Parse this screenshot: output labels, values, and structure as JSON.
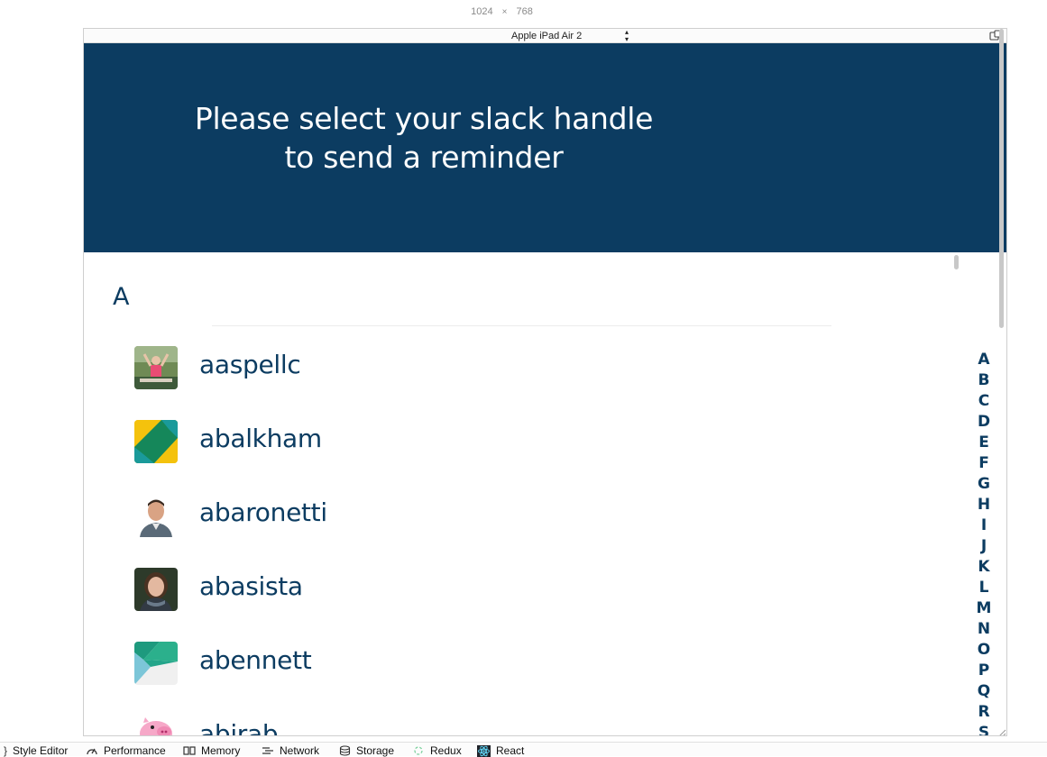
{
  "responsive": {
    "width": "1024",
    "times": "×",
    "height": "768",
    "device": "Apple iPad Air 2"
  },
  "header": {
    "line1": "Please select your slack handle",
    "line2": "to send a reminder",
    "background": "#0c3c61"
  },
  "section": {
    "letter": "A"
  },
  "users": [
    {
      "handle": "aaspellc",
      "avatar": "photo-kayaker-avatar"
    },
    {
      "handle": "abalkham",
      "avatar": "yellow-green-pattern-avatar"
    },
    {
      "handle": "abaronetti",
      "avatar": "photo-man-avatar"
    },
    {
      "handle": "abasista",
      "avatar": "photo-woman-avatar"
    },
    {
      "handle": "abennett",
      "avatar": "teal-pattern-avatar"
    },
    {
      "handle": "abirab",
      "avatar": "pink-pig-avatar"
    }
  ],
  "alphabet": [
    "A",
    "B",
    "C",
    "D",
    "E",
    "F",
    "G",
    "H",
    "I",
    "J",
    "K",
    "L",
    "M",
    "N",
    "O",
    "P",
    "Q",
    "R",
    "S"
  ],
  "devtools": {
    "tabs": [
      {
        "label": "Style Editor",
        "icon": "brace-icon"
      },
      {
        "label": "Performance",
        "icon": "gauge-icon"
      },
      {
        "label": "Memory",
        "icon": "memory-chip-icon"
      },
      {
        "label": "Network",
        "icon": "network-lines-icon"
      },
      {
        "label": "Storage",
        "icon": "database-icon"
      },
      {
        "label": "Redux",
        "icon": "redux-icon"
      },
      {
        "label": "React",
        "icon": "react-atom-icon"
      }
    ]
  }
}
